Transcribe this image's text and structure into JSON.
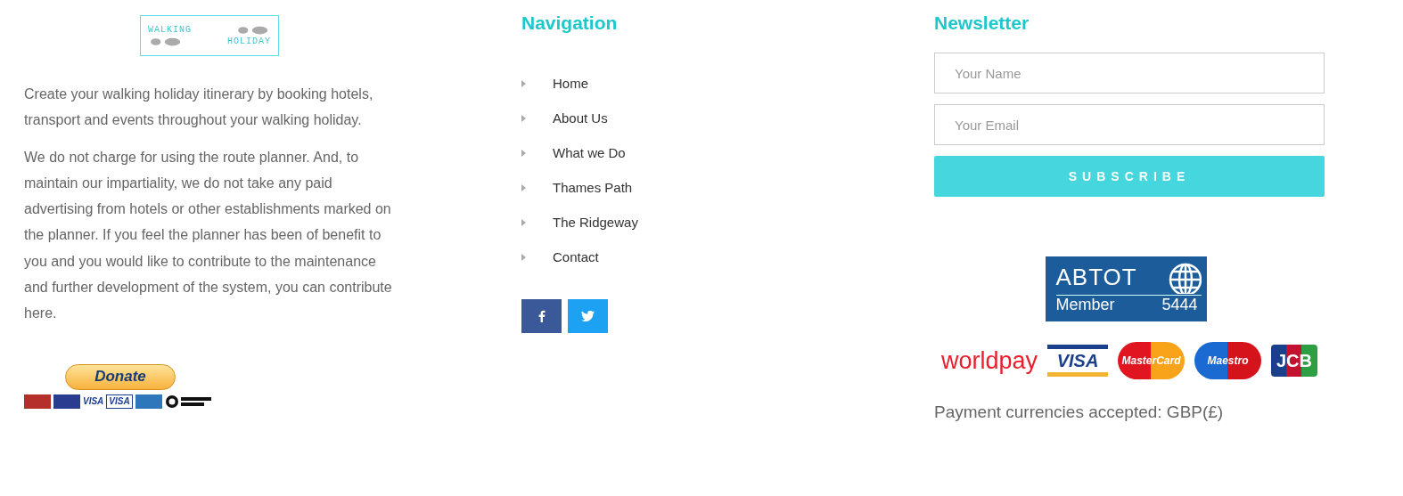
{
  "logo": {
    "line_1": "WALKING",
    "line_2": "HOLIDAY"
  },
  "about": [
    "Create your walking holiday itinerary by booking hotels, transport and events throughout your walking holiday.",
    "We do not charge for using the route planner. And, to maintain our impartiality, we do not take any paid advertising from hotels or other establishments marked on the planner. If you feel the planner has been of benefit to you and you would like to contribute to the maintenance and further development of the system, you can contribute here."
  ],
  "donate": {
    "label": "Donate",
    "cards": [
      {
        "kind": "mastercard"
      },
      {
        "kind": "maestro"
      },
      {
        "kind": "visa",
        "text": "VISA"
      },
      {
        "kind": "visa-box",
        "text": "VISA"
      },
      {
        "kind": "amex"
      },
      {
        "kind": "direct-debit"
      }
    ]
  },
  "navigation": {
    "title": "Navigation",
    "items": [
      "Home",
      "About Us",
      "What we Do",
      "Thames Path",
      "The Ridgeway",
      "Contact"
    ],
    "social": [
      {
        "kind": "facebook"
      },
      {
        "kind": "twitter"
      }
    ]
  },
  "newsletter": {
    "title": "Newsletter",
    "name_placeholder": "Your Name",
    "email_placeholder": "Your Email",
    "button": "SUBSCRIBE"
  },
  "badge": {
    "title": "ABTOT",
    "label": "Member",
    "number": "5444"
  },
  "payment_logos": [
    {
      "kind": "worldpay",
      "text": "worldpay"
    },
    {
      "kind": "visa",
      "text": "VISA"
    },
    {
      "kind": "mastercard",
      "text": "MasterCard"
    },
    {
      "kind": "maestro",
      "text": "Maestro"
    },
    {
      "kind": "jcb",
      "text": "JCB"
    }
  ],
  "currencies": "Payment currencies accepted: GBP(£)"
}
